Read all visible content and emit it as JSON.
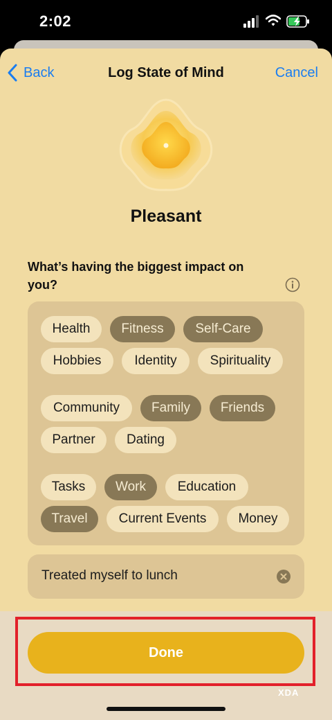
{
  "status_bar": {
    "time": "2:02"
  },
  "nav": {
    "back_label": "Back",
    "title": "Log State of Mind",
    "cancel_label": "Cancel"
  },
  "mood": {
    "label": "Pleasant"
  },
  "impact": {
    "question": "What’s having the biggest impact on you?",
    "groups": [
      [
        {
          "label": "Health",
          "selected": false
        },
        {
          "label": "Fitness",
          "selected": true
        },
        {
          "label": "Self-Care",
          "selected": true
        },
        {
          "label": "Hobbies",
          "selected": false
        },
        {
          "label": "Identity",
          "selected": false
        },
        {
          "label": "Spirituality",
          "selected": false
        }
      ],
      [
        {
          "label": "Community",
          "selected": false
        },
        {
          "label": "Family",
          "selected": true
        },
        {
          "label": "Friends",
          "selected": true
        },
        {
          "label": "Partner",
          "selected": false
        },
        {
          "label": "Dating",
          "selected": false
        }
      ],
      [
        {
          "label": "Tasks",
          "selected": false
        },
        {
          "label": "Work",
          "selected": true
        },
        {
          "label": "Education",
          "selected": false
        },
        {
          "label": "Travel",
          "selected": true
        },
        {
          "label": "Current Events",
          "selected": false
        },
        {
          "label": "Money",
          "selected": false
        }
      ]
    ]
  },
  "note": {
    "text": "Treated myself to lunch"
  },
  "footer": {
    "done_label": "Done",
    "watermark": "XDA"
  },
  "colors": {
    "sheet_background": "#f1dba2",
    "accent_link": "#1a7df0",
    "done_button": "#e8b21c",
    "chip_selected": "#887856",
    "chip_unselected": "#f3e3bc",
    "highlight_border": "#e2202a"
  }
}
